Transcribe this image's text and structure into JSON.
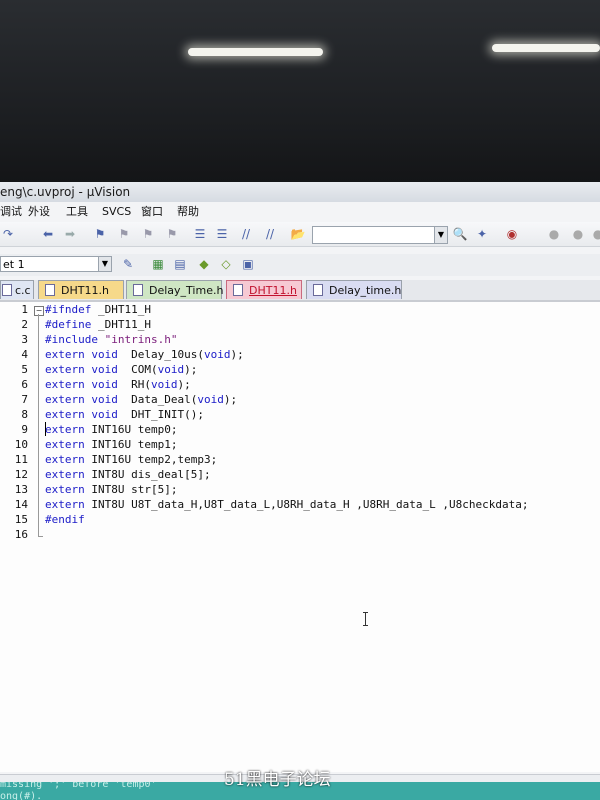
{
  "window": {
    "title": "eng\\c.uvproj - µVision"
  },
  "menu": [
    "调试",
    "外设",
    "工具",
    "SVCS",
    "窗口",
    "帮助"
  ],
  "target": {
    "name": "et 1"
  },
  "tabs": [
    {
      "label": "c.c"
    },
    {
      "label": "DHT11.h"
    },
    {
      "label": "Delay_Time.h"
    },
    {
      "label": "DHT11.h",
      "active": true
    },
    {
      "label": "Delay_time.h"
    }
  ],
  "editor": {
    "lines": [
      {
        "n": "1",
        "parts": [
          [
            "pp",
            "#ifndef"
          ],
          [
            "t",
            " _DHT11_H"
          ]
        ]
      },
      {
        "n": "2",
        "parts": [
          [
            "pp",
            "#define"
          ],
          [
            "t",
            " _DHT11_H"
          ]
        ]
      },
      {
        "n": "3",
        "parts": [
          [
            "pp",
            "#include"
          ],
          [
            "t",
            " "
          ],
          [
            "str",
            "\"intrins.h\""
          ]
        ]
      },
      {
        "n": "4",
        "parts": [
          [
            "kw",
            "extern"
          ],
          [
            "t",
            " "
          ],
          [
            "kw",
            "void"
          ],
          [
            "t",
            "  Delay_10us("
          ],
          [
            "kw",
            "void"
          ],
          [
            "t",
            ");"
          ]
        ]
      },
      {
        "n": "5",
        "parts": [
          [
            "kw",
            "extern"
          ],
          [
            "t",
            " "
          ],
          [
            "kw",
            "void"
          ],
          [
            "t",
            "  COM("
          ],
          [
            "kw",
            "void"
          ],
          [
            "t",
            ");"
          ]
        ]
      },
      {
        "n": "6",
        "parts": [
          [
            "kw",
            "extern"
          ],
          [
            "t",
            " "
          ],
          [
            "kw",
            "void"
          ],
          [
            "t",
            "  RH("
          ],
          [
            "kw",
            "void"
          ],
          [
            "t",
            ");"
          ]
        ]
      },
      {
        "n": "7",
        "parts": [
          [
            "kw",
            "extern"
          ],
          [
            "t",
            " "
          ],
          [
            "kw",
            "void"
          ],
          [
            "t",
            "  Data_Deal("
          ],
          [
            "kw",
            "void"
          ],
          [
            "t",
            ");"
          ]
        ]
      },
      {
        "n": "8",
        "parts": [
          [
            "kw",
            "extern"
          ],
          [
            "t",
            " "
          ],
          [
            "kw",
            "void"
          ],
          [
            "t",
            "  DHT_INIT();"
          ]
        ]
      },
      {
        "n": "9",
        "parts": [
          [
            "kw",
            "extern"
          ],
          [
            "t",
            " INT16U temp0;"
          ]
        ]
      },
      {
        "n": "10",
        "parts": [
          [
            "kw",
            "extern"
          ],
          [
            "t",
            " INT16U temp1;"
          ]
        ]
      },
      {
        "n": "11",
        "parts": [
          [
            "kw",
            "extern"
          ],
          [
            "t",
            " INT16U temp2,temp3;"
          ]
        ]
      },
      {
        "n": "12",
        "parts": [
          [
            "kw",
            "extern"
          ],
          [
            "t",
            " INT8U dis_deal[5];"
          ]
        ]
      },
      {
        "n": "13",
        "parts": [
          [
            "kw",
            "extern"
          ],
          [
            "t",
            " INT8U str[5];"
          ]
        ]
      },
      {
        "n": "14",
        "parts": [
          [
            "kw",
            "extern"
          ],
          [
            "t",
            " INT8U U8T_data_H,U8T_data_L,U8RH_data_H ,U8RH_data_L ,U8checkdata;"
          ]
        ]
      },
      {
        "n": "15",
        "parts": [
          [
            "pp",
            "#endif"
          ]
        ]
      },
      {
        "n": "16",
        "parts": []
      }
    ]
  },
  "build_output": {
    "line1": "missing ';' before 'temp0'",
    "line2": "ong(#)."
  },
  "watermark": "51黑电子论坛",
  "colors": {
    "keyword": "#1c1cc8",
    "build_bg": "#3aa9a3",
    "active_tab": "#f6c9d3"
  }
}
